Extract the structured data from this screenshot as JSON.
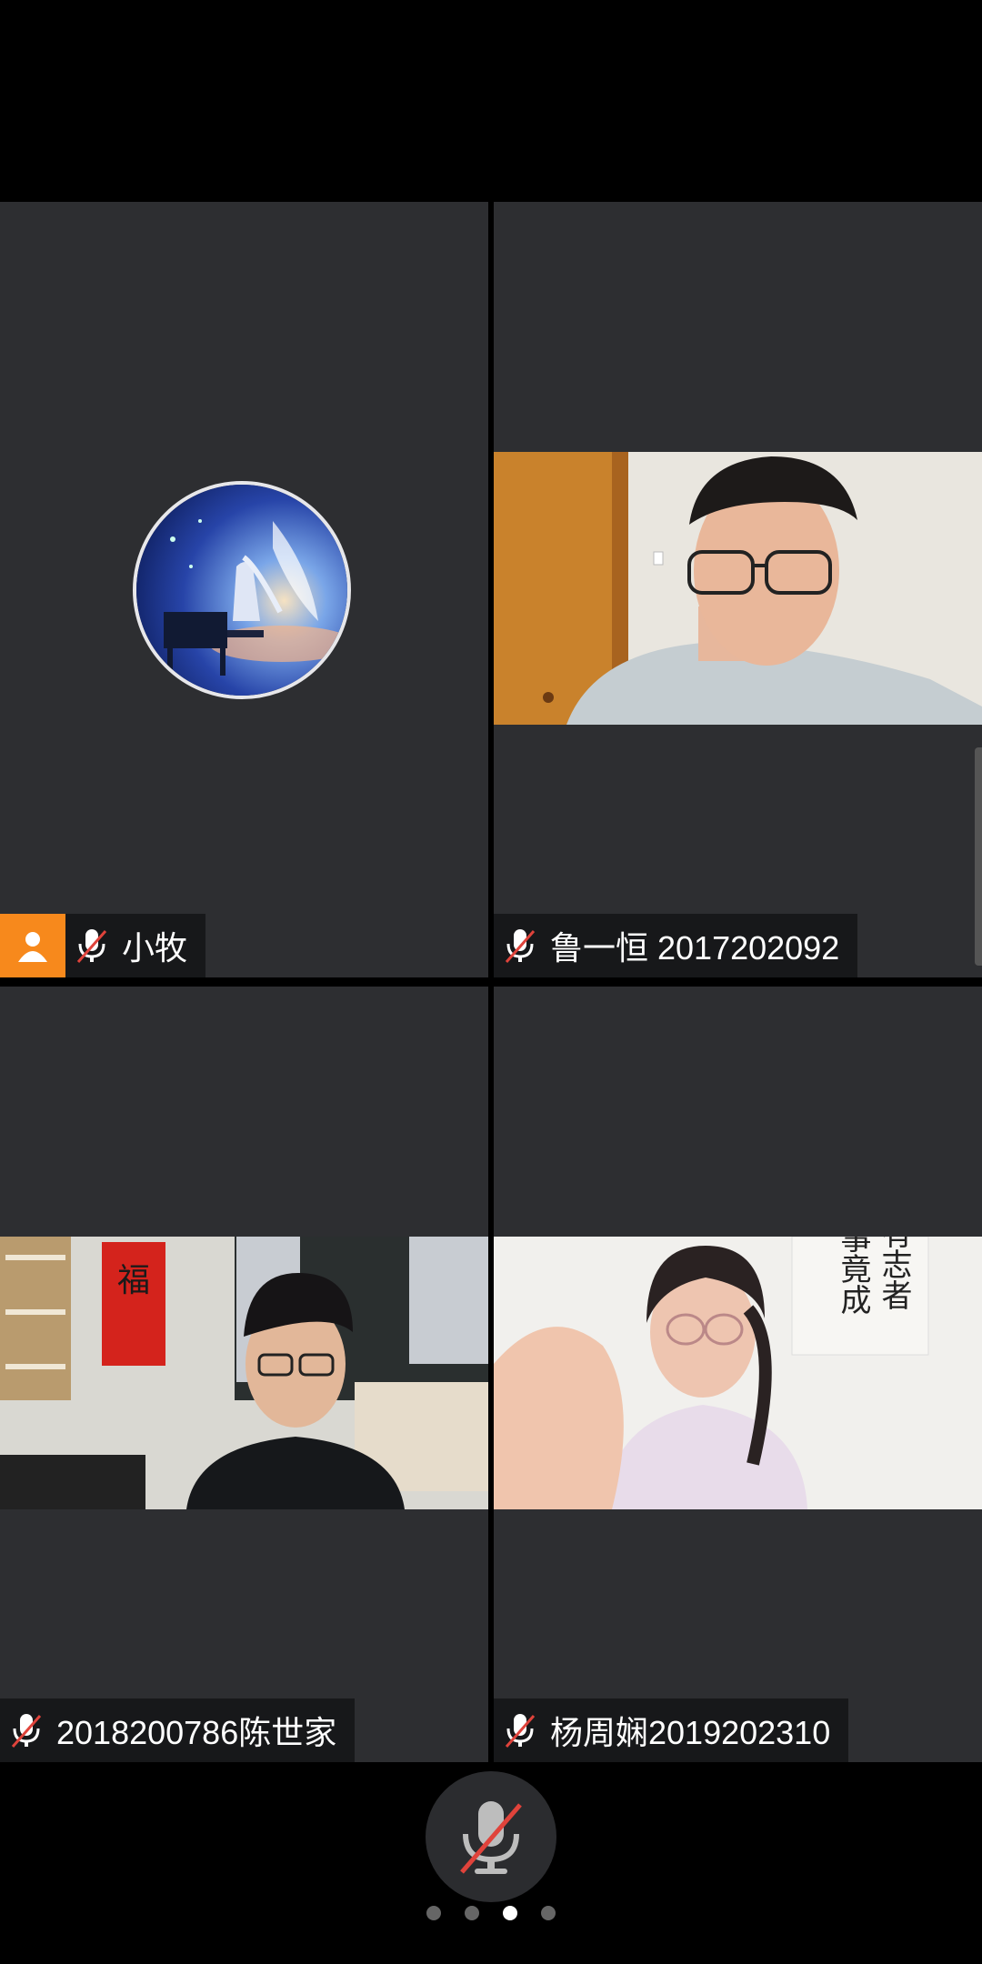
{
  "participants": [
    {
      "name": "小牧",
      "muted": true,
      "host": true,
      "video": false,
      "avatar_icon": "avatar-anime-piano"
    },
    {
      "name": "鲁一恒 2017202092",
      "muted": true,
      "host": false,
      "video": true
    },
    {
      "name": "2018200786陈世家",
      "muted": true,
      "host": false,
      "video": true
    },
    {
      "name": "杨周娴2019202310",
      "muted": true,
      "host": false,
      "video": true
    }
  ],
  "calligraphy": [
    "有志者",
    "事竟成"
  ],
  "poster_char": "福",
  "self_mic": {
    "muted": true,
    "icon": "mic-muted-icon"
  },
  "pager": {
    "pages": 4,
    "current": 3
  },
  "colors": {
    "host_badge": "#f7891c",
    "tile_bg": "#2d2e31",
    "muted_slash": "#e0433b"
  }
}
